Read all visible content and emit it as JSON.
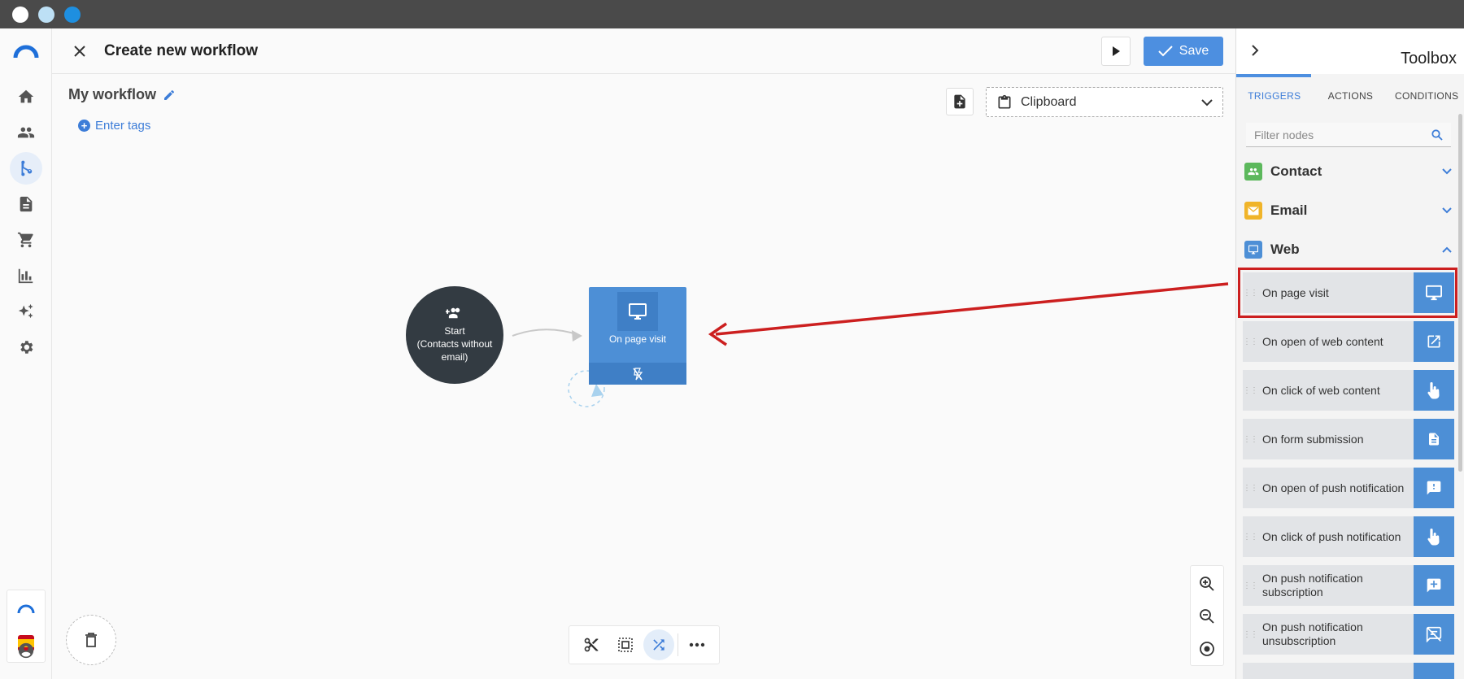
{
  "window": {
    "controls": [
      {
        "name": "close",
        "color": "#ffffff"
      },
      {
        "name": "minimize",
        "color": "#bde0f5"
      },
      {
        "name": "maximize",
        "color": "#1e8fe0"
      }
    ]
  },
  "sidebar": {
    "logo": "logo-icon",
    "items": [
      {
        "icon": "home-icon"
      },
      {
        "icon": "contacts-icon"
      },
      {
        "icon": "workflow-icon",
        "active": true
      },
      {
        "icon": "document-icon"
      },
      {
        "icon": "cart-icon"
      },
      {
        "icon": "chart-icon"
      },
      {
        "icon": "sparkle-icon"
      },
      {
        "icon": "gear-icon"
      }
    ],
    "flag_icon": "spain-flag-icon",
    "user_icon": "account-icon"
  },
  "header": {
    "title": "Create new workflow",
    "save_label": "Save"
  },
  "workflow": {
    "name": "My workflow",
    "tags_label": "Enter tags",
    "clipboard_label": "Clipboard"
  },
  "canvas": {
    "start_node": {
      "line1": "Start",
      "line2": "(Contacts without email)"
    },
    "page_node": {
      "label": "On page visit"
    }
  },
  "toolbox": {
    "title": "Toolbox",
    "tabs": [
      "TRIGGERS",
      "ACTIONS",
      "CONDITIONS"
    ],
    "filter_placeholder": "Filter nodes",
    "categories": [
      {
        "label": "Contact",
        "color": "#5cb85c"
      },
      {
        "label": "Email",
        "color": "#f0b429"
      },
      {
        "label": "Web",
        "color": "#4d8fd6"
      }
    ],
    "items": [
      {
        "label": "On page visit",
        "icon": "monitor-icon"
      },
      {
        "label": "On open of web content",
        "icon": "open-external-icon"
      },
      {
        "label": "On click of web content",
        "icon": "touch-icon"
      },
      {
        "label": "On form submission",
        "icon": "form-icon"
      },
      {
        "label": "On open of push notification",
        "icon": "push-alert-icon"
      },
      {
        "label": "On click of push notification",
        "icon": "touch-icon"
      },
      {
        "label": "On push notification subscription",
        "icon": "push-add-icon"
      },
      {
        "label": "On push notification unsubscription",
        "icon": "push-off-icon"
      }
    ]
  },
  "colors": {
    "accent": "#4d8fe0",
    "node": "#4d8fd6",
    "start_node": "#333b42",
    "highlight": "#cc1f1f"
  }
}
